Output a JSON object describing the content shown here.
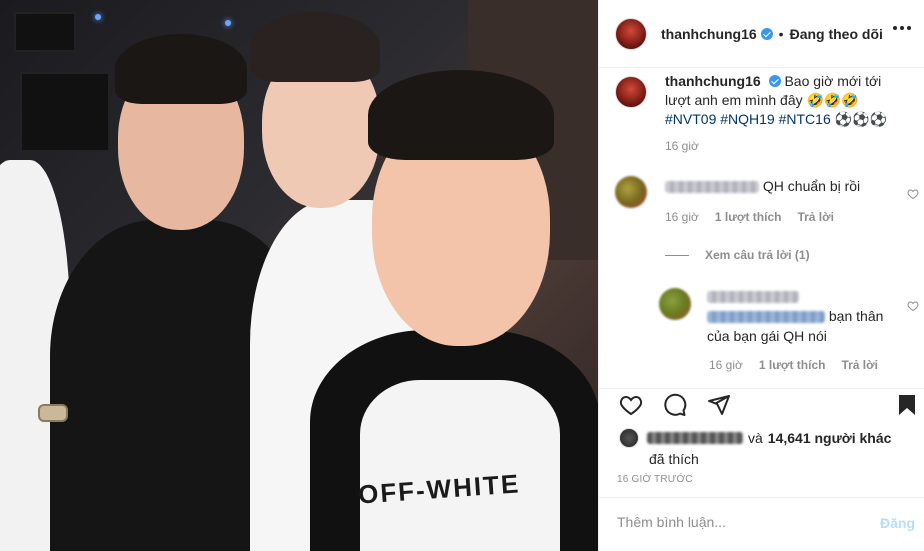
{
  "post": {
    "username": "thanhchung16",
    "follow_status": "Đang theo dõi",
    "caption": {
      "username": "thanhchung16",
      "text": "Bao giờ mới tới lượt anh em mình đây 🤣🤣🤣",
      "hashtags": [
        "#NVT09",
        "#NQH19",
        "#NTC16"
      ],
      "suffix": "⚽⚽⚽",
      "time": "16 giờ"
    },
    "comments": [
      {
        "text": "QH chuẩn bị rồi",
        "time": "16 giờ",
        "likes": "1 lượt thích",
        "reply": "Trả lời"
      }
    ],
    "view_replies": "Xem câu trả lời (1)",
    "reply": {
      "text": "bạn thân của bạn gái QH nói",
      "time": "16 giờ",
      "likes": "1 lượt thích",
      "reply": "Trả lời"
    },
    "likes": {
      "conj": "và",
      "others": "14,641 người khác",
      "liked": "đã thích"
    },
    "time_ago": "16 GIỜ TRƯỚC",
    "add_comment": {
      "placeholder": "Thêm bình luận...",
      "post_label": "Đăng"
    },
    "photo_print": "OFF-WHITE"
  }
}
